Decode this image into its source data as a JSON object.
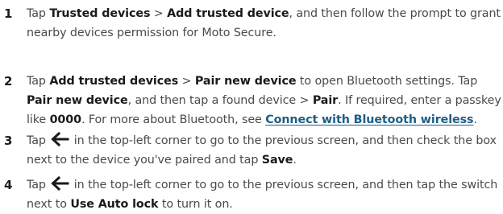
{
  "steps": [
    {
      "number": "1",
      "parts": [
        "Tap ",
        "Trusted devices",
        " > ",
        "Add trusted device",
        ", and then follow the prompt to grant nearby devices permission for Moto Secure."
      ]
    },
    {
      "number": "2",
      "parts": [
        "Tap ",
        "Add trusted devices",
        " > ",
        "Pair new device",
        " to open Bluetooth settings. Tap ",
        "Pair new device",
        ", and then tap a found device > ",
        "Pair",
        ". If required, enter a passkey like ",
        "0000",
        ". For more about Bluetooth, see ",
        "Connect with Bluetooth wireless",
        "."
      ]
    },
    {
      "number": "3",
      "parts": [
        "Tap ",
        " in the top-left corner to go to the previous screen, and then check the box next to the device you've paired and tap ",
        "Save",
        "."
      ]
    },
    {
      "number": "4",
      "parts": [
        "Tap ",
        " in the top-left corner to go to the previous screen, and then tap the switch next to ",
        "Use Auto lock",
        " to turn it on."
      ]
    }
  ],
  "icons": {
    "back_arrow": "back-arrow-icon"
  },
  "colors": {
    "text": "#4a4a4a",
    "bold": "#1a1a1a",
    "link": "#1f5e85"
  }
}
